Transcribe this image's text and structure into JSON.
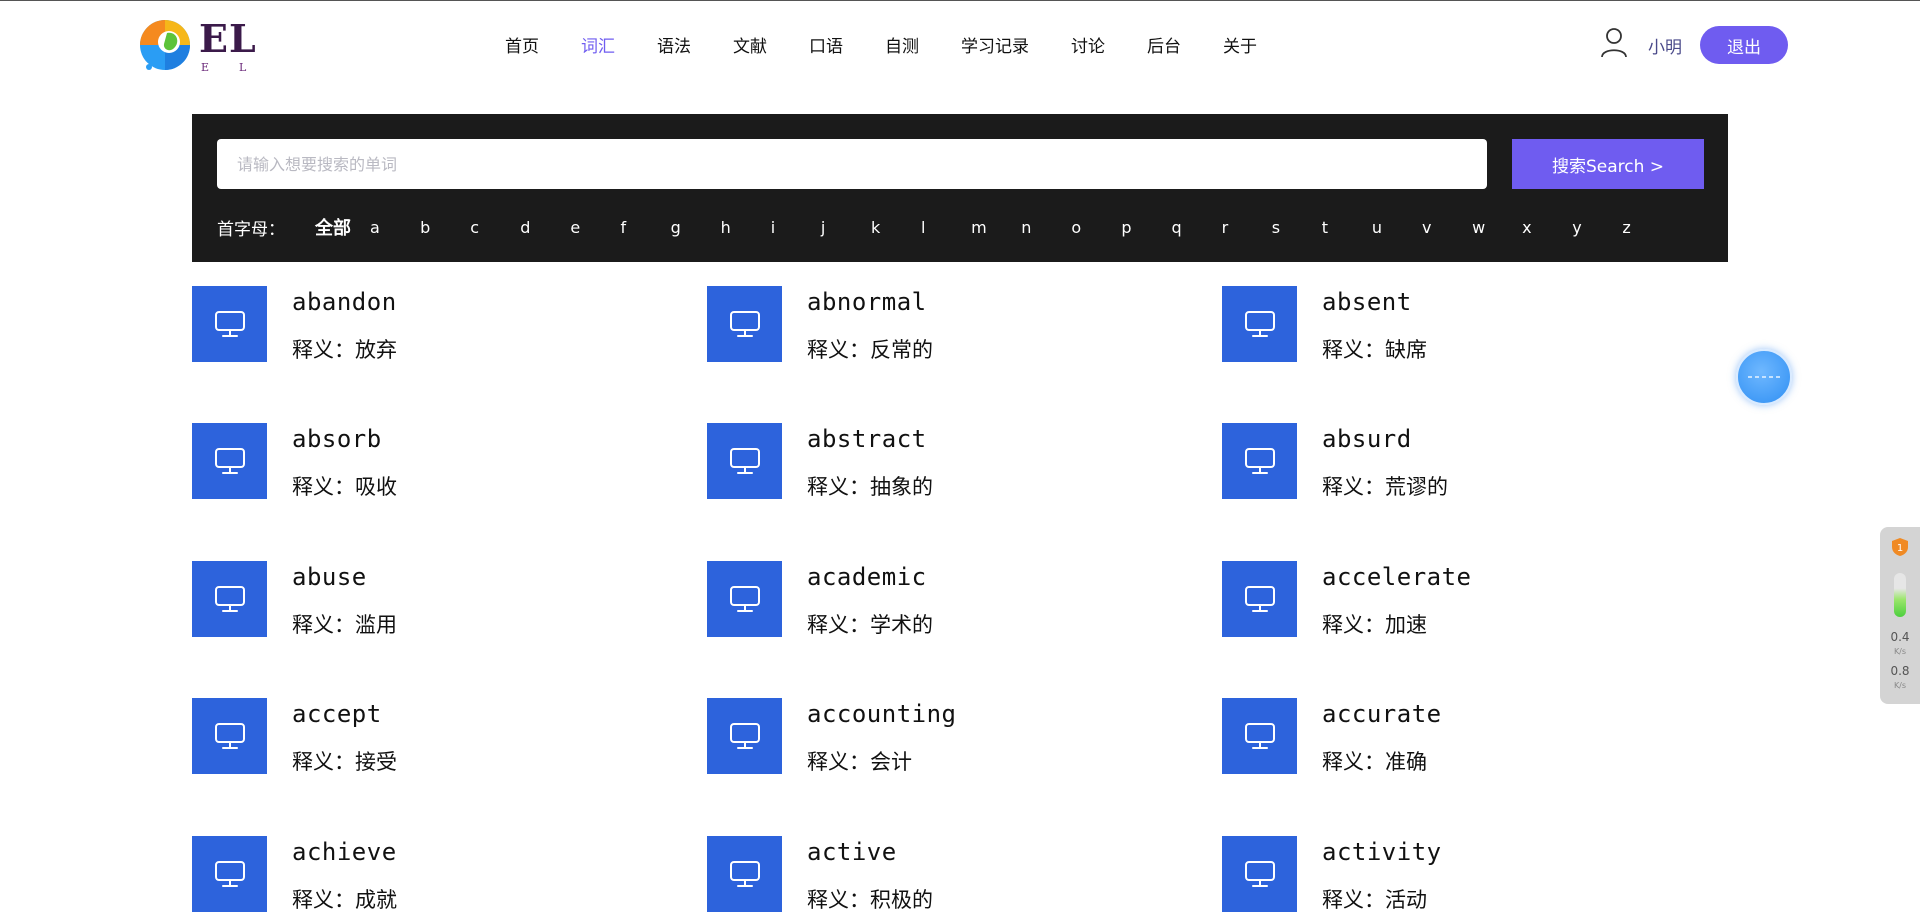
{
  "header": {
    "logo_text": "EL",
    "logo_sub": "EL",
    "nav": [
      {
        "label": "首页",
        "active": false
      },
      {
        "label": "词汇",
        "active": true
      },
      {
        "label": "语法",
        "active": false
      },
      {
        "label": "文献",
        "active": false
      },
      {
        "label": "口语",
        "active": false
      },
      {
        "label": "自测",
        "active": false
      },
      {
        "label": "学习记录",
        "active": false
      },
      {
        "label": "讨论",
        "active": false
      },
      {
        "label": "后台",
        "active": false
      },
      {
        "label": "关于",
        "active": false
      }
    ],
    "user_name": "小明",
    "logout_label": "退出"
  },
  "search": {
    "placeholder": "请输入想要搜索的单词",
    "value": "",
    "button_label": "搜索Search >",
    "letters_label": "首字母：",
    "all_label": "全部",
    "letters": [
      "a",
      "b",
      "c",
      "d",
      "e",
      "f",
      "g",
      "h",
      "i",
      "j",
      "k",
      "l",
      "m",
      "n",
      "o",
      "p",
      "q",
      "r",
      "s",
      "t",
      "u",
      "v",
      "w",
      "x",
      "y",
      "z"
    ]
  },
  "words": [
    {
      "word": "abandon",
      "meaning": "释义：放弃"
    },
    {
      "word": "abnormal",
      "meaning": "释义：反常的"
    },
    {
      "word": "absent",
      "meaning": "释义：缺席"
    },
    {
      "word": "absorb",
      "meaning": "释义：吸收"
    },
    {
      "word": "abstract",
      "meaning": "释义：抽象的"
    },
    {
      "word": "absurd",
      "meaning": "释义：荒谬的"
    },
    {
      "word": "abuse",
      "meaning": "释义：滥用"
    },
    {
      "word": "academic",
      "meaning": "释义：学术的"
    },
    {
      "word": "accelerate",
      "meaning": "释义：加速"
    },
    {
      "word": "accept",
      "meaning": "释义：接受"
    },
    {
      "word": "accounting",
      "meaning": "释义：会计"
    },
    {
      "word": "accurate",
      "meaning": "释义：准确"
    },
    {
      "word": "achieve",
      "meaning": "释义：成就"
    },
    {
      "word": "active",
      "meaning": "释义：积极的"
    },
    {
      "word": "activity",
      "meaning": "释义：活动"
    }
  ],
  "net_widget": {
    "badge": "1",
    "upload_value": "0.4",
    "upload_unit": "K/s",
    "download_value": "0.8",
    "download_unit": "K/s"
  },
  "colors": {
    "accent": "#6f5cf0",
    "icon_tile": "#2d63dc",
    "search_panel": "#1b1b1b"
  }
}
